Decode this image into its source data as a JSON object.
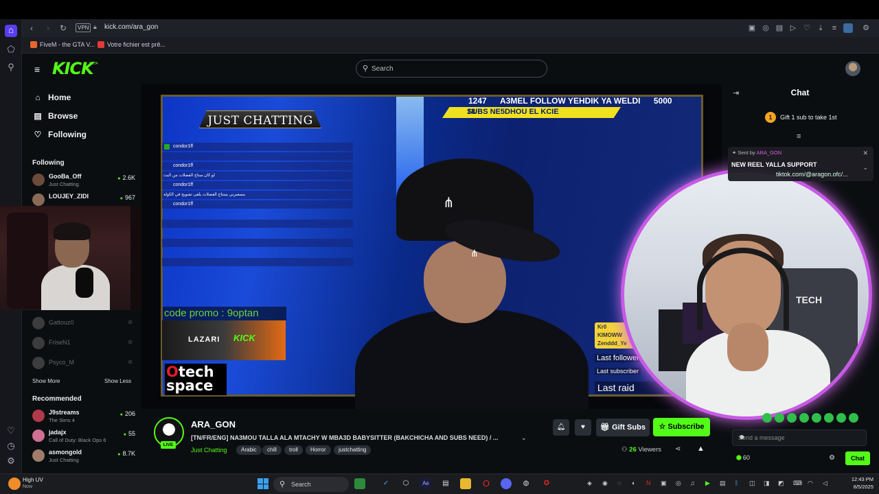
{
  "browser": {
    "url": "kick.com/ara_gon",
    "vpn_label": "VPN",
    "bookmarks": [
      {
        "label": "FiveM - the GTA V...",
        "color": "#e8662d"
      },
      {
        "label": "Votre fichier est prê...",
        "color": "#e23a3a"
      }
    ]
  },
  "kick": {
    "logo": "KICK",
    "logo_beta": "BETA",
    "search_placeholder": "Search",
    "nav": [
      {
        "label": "Home",
        "icon": "home-icon"
      },
      {
        "label": "Browse",
        "icon": "browse-icon"
      },
      {
        "label": "Following",
        "icon": "heart-icon"
      }
    ],
    "following_title": "Following",
    "following": [
      {
        "name": "GooBa_Off",
        "category": "Just Chatting",
        "viewers": "2.6K",
        "online": true
      },
      {
        "name": "LOUJEY_ZIDI",
        "category": "Just Chatting",
        "viewers": "967",
        "online": true
      },
      {
        "name": "Gattouz0",
        "online": false
      },
      {
        "name": "FriseN1",
        "online": false
      },
      {
        "name": "Psyco_M",
        "online": false
      }
    ],
    "show_more": "Show More",
    "show_less": "Show Less",
    "recommended_title": "Recommended",
    "recommended": [
      {
        "name": "J9streams",
        "category": "The Sims 4",
        "viewers": "206"
      },
      {
        "name": "jadajx",
        "category": "Call of Duty: Black Ops 6",
        "viewers": "55"
      },
      {
        "name": "asmongold",
        "category": "Just Chatting",
        "viewers": "8.7K"
      }
    ]
  },
  "video": {
    "banner": "JUST CHATTING",
    "goal_count": "1247",
    "goal_text": "A3MEL FOLLOW YEHDIK YA WELDI",
    "goal_target": "5000",
    "subs_count": "18",
    "subs_text": "SUBS NE5DHOU EL KCIE",
    "stream_chat": [
      {
        "name": "condor1ff",
        "msg": ""
      },
      {
        "name": "condor1ff",
        "msg": "لو كان ستاج الفضلات من البث"
      },
      {
        "name": "condor1ff",
        "msg": "مسعبرني يستاج الفضلات يلقى تشويح في الكولة"
      },
      {
        "name": "condor1ff",
        "msg": ""
      }
    ],
    "promo": "code promo : 9optan",
    "sponsor1": "LAZARI",
    "sponsor2": "KICK",
    "techspace_line1": "Otech",
    "techspace_line2": "space",
    "alert_name": "Kr0",
    "alert_name2": "KIMOWW",
    "alert_name3": "Zenddd_Ye",
    "last_follower": "Last follower",
    "last_subscriber": "Last subscriber",
    "last_raid": "Last raid",
    "cam_brand": "TECH"
  },
  "chat": {
    "title": "Chat",
    "gift_banner": "Gift 1 sub to take 1st",
    "gift_count": "1",
    "pinned_sent_by": "Sent by",
    "pinned_author": "ARA_GON",
    "pinned_message": "NEW REEL YALLA SUPPORT",
    "pinned_link": "tiktok.com/@aragon.ofc/...",
    "input_placeholder": "Send a message",
    "points": "60",
    "send_label": "Chat"
  },
  "stream": {
    "streamer": "ARA_GON",
    "live_label": "LIVE",
    "title": "[TN/FR/ENG] NA3MOU TALLA ALA MTACHY W MBA3D BABYSITTER  (BAKCHICHA AND SUBS NEED) / ...",
    "category": "Just Chatting",
    "tags": [
      "Arabic",
      "chill",
      "troll",
      "Horror",
      "justchatting"
    ],
    "gift_subs": "Gift Subs",
    "subscribe": "Subscribe",
    "viewers_count": "26",
    "viewers_label": "Viewers"
  },
  "taskbar": {
    "weather_title": "High UV",
    "weather_sub": "Now",
    "search": "Search",
    "time": "12:43 PM",
    "date": "8/5/2025"
  },
  "colors": {
    "kick_green": "#53fc18",
    "ring": "#c85ae6"
  }
}
